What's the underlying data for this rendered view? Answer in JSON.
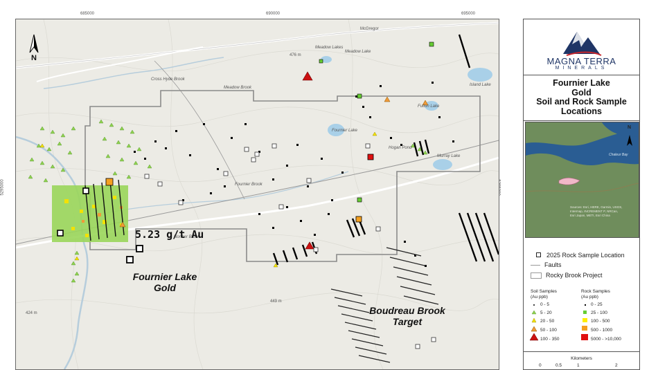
{
  "map": {
    "top_ticks": [
      "685000",
      "690000",
      "695000"
    ],
    "left_ticks": [
      "5295000"
    ],
    "right_ticks": [
      "5295000"
    ],
    "north_label": "N",
    "place_labels": [
      "McGregor",
      "Meadow Lakes",
      "Meadow Lake",
      "Island Lake",
      "Fulton Lake",
      "Fournier Lake",
      "Hogan Pond",
      "Murray Lake",
      "Fournier Brook",
      "Cross Hyde Brook",
      "Meadow Brook",
      "Norther Brook",
      "476 m",
      "449 m",
      "424 m"
    ],
    "highlight_label": "5.23 g/t Au",
    "project_label": [
      "Fournier Lake",
      "Gold"
    ],
    "target_label": [
      "Boudreau Brook",
      "Target"
    ]
  },
  "legend": {
    "company": [
      "MAGNA TERRA",
      "MINERALS"
    ],
    "title": [
      "Fournier Lake",
      "Gold",
      "Soil and Rock Sample",
      "Locations"
    ],
    "inset_labels": [
      "Chaleur Bay"
    ],
    "inset_credit": [
      "Sources: Esri, HERE, Garmin, USGS,",
      "Intermap, INCREMENT P, NRCan,",
      "Esri Japan, METI, Esri China"
    ],
    "items": {
      "rock_sample_2025": "2025 Rock Sample Location",
      "faults": "Faults",
      "project": "Rocky Brook Project"
    },
    "soil_header": [
      "Soil Samples",
      "(Au ppb)"
    ],
    "rock_header": [
      "Rock Samples",
      "(Au ppb)"
    ],
    "soil_classes": [
      "0 - 5",
      "5 - 20",
      "20 - 50",
      "50 - 100",
      "100 - 350"
    ],
    "rock_classes": [
      "0 - 25",
      "25 - 100",
      "100 - 500",
      "500 - 1000",
      "5000 - >10,000"
    ],
    "scale_title": "Kilometers",
    "scale_ticks": [
      "0",
      "0.5",
      "1",
      "2"
    ],
    "colors": {
      "soil_green": "#8fd14f",
      "soil_yellow": "#f5e400",
      "soil_orange": "#f0a040",
      "soil_red": "#cc1111",
      "rock_black": "#000000",
      "rock_green": "#66cc33",
      "rock_yellow": "#ffee00",
      "rock_orange": "#f4a020",
      "rock_red": "#e01010",
      "brand_navy": "#1f3566"
    }
  }
}
